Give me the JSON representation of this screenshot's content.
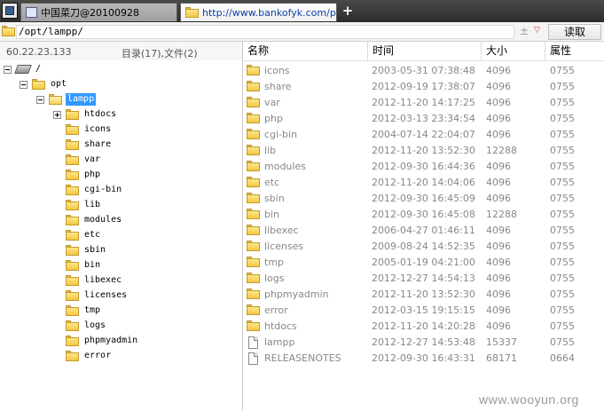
{
  "tabs": [
    {
      "label": "中国菜刀@20100928",
      "active": false
    },
    {
      "label": "http://www.bankofyk.com/pl...",
      "active": true
    }
  ],
  "new_tab_symbol": "+",
  "pathbar": {
    "path": "/opt/lampp/",
    "plusminus": "±",
    "dropdown": "▽",
    "read_button": "读取"
  },
  "left": {
    "ip": "60.22.23.133",
    "count": "目录(17),文件(2)",
    "tree": [
      {
        "label": "/",
        "kind": "drive",
        "expander": "minus"
      },
      {
        "label": "opt",
        "kind": "folder",
        "expander": "minus"
      },
      {
        "label": "lampp",
        "kind": "folder-open",
        "expander": "minus",
        "selected": true
      },
      {
        "label": "htdocs",
        "kind": "folder",
        "expander": "plus"
      },
      {
        "label": "icons",
        "kind": "folder"
      },
      {
        "label": "share",
        "kind": "folder"
      },
      {
        "label": "var",
        "kind": "folder"
      },
      {
        "label": "php",
        "kind": "folder"
      },
      {
        "label": "cgi-bin",
        "kind": "folder"
      },
      {
        "label": "lib",
        "kind": "folder"
      },
      {
        "label": "modules",
        "kind": "folder"
      },
      {
        "label": "etc",
        "kind": "folder"
      },
      {
        "label": "sbin",
        "kind": "folder"
      },
      {
        "label": "bin",
        "kind": "folder"
      },
      {
        "label": "libexec",
        "kind": "folder"
      },
      {
        "label": "licenses",
        "kind": "folder"
      },
      {
        "label": "tmp",
        "kind": "folder"
      },
      {
        "label": "logs",
        "kind": "folder"
      },
      {
        "label": "phpmyadmin",
        "kind": "folder"
      },
      {
        "label": "error",
        "kind": "folder"
      }
    ]
  },
  "columns": {
    "name": "名称",
    "time": "时间",
    "size": "大小",
    "attr": "属性"
  },
  "files": [
    {
      "name": "icons",
      "time": "2003-05-31 07:38:48",
      "size": "4096",
      "attr": "0755",
      "type": "dir"
    },
    {
      "name": "share",
      "time": "2012-09-19 17:38:07",
      "size": "4096",
      "attr": "0755",
      "type": "dir"
    },
    {
      "name": "var",
      "time": "2012-11-20 14:17:25",
      "size": "4096",
      "attr": "0755",
      "type": "dir"
    },
    {
      "name": "php",
      "time": "2012-03-13 23:34:54",
      "size": "4096",
      "attr": "0755",
      "type": "dir"
    },
    {
      "name": "cgi-bin",
      "time": "2004-07-14 22:04:07",
      "size": "4096",
      "attr": "0755",
      "type": "dir"
    },
    {
      "name": "lib",
      "time": "2012-11-20 13:52:30",
      "size": "12288",
      "attr": "0755",
      "type": "dir"
    },
    {
      "name": "modules",
      "time": "2012-09-30 16:44:36",
      "size": "4096",
      "attr": "0755",
      "type": "dir"
    },
    {
      "name": "etc",
      "time": "2012-11-20 14:04:06",
      "size": "4096",
      "attr": "0755",
      "type": "dir"
    },
    {
      "name": "sbin",
      "time": "2012-09-30 16:45:09",
      "size": "4096",
      "attr": "0755",
      "type": "dir"
    },
    {
      "name": "bin",
      "time": "2012-09-30 16:45:08",
      "size": "12288",
      "attr": "0755",
      "type": "dir"
    },
    {
      "name": "libexec",
      "time": "2006-04-27 01:46:11",
      "size": "4096",
      "attr": "0755",
      "type": "dir"
    },
    {
      "name": "licenses",
      "time": "2009-08-24 14:52:35",
      "size": "4096",
      "attr": "0755",
      "type": "dir"
    },
    {
      "name": "tmp",
      "time": "2005-01-19 04:21:00",
      "size": "4096",
      "attr": "0755",
      "type": "dir"
    },
    {
      "name": "logs",
      "time": "2012-12-27 14:54:13",
      "size": "4096",
      "attr": "0755",
      "type": "dir"
    },
    {
      "name": "phpmyadmin",
      "time": "2012-11-20 13:52:30",
      "size": "4096",
      "attr": "0755",
      "type": "dir"
    },
    {
      "name": "error",
      "time": "2012-03-15 19:15:15",
      "size": "4096",
      "attr": "0755",
      "type": "dir"
    },
    {
      "name": "htdocs",
      "time": "2012-11-20 14:20:28",
      "size": "4096",
      "attr": "0755",
      "type": "dir"
    },
    {
      "name": "lampp",
      "time": "2012-12-27 14:53:48",
      "size": "15337",
      "attr": "0755",
      "type": "file"
    },
    {
      "name": "RELEASENOTES",
      "time": "2012-09-30 16:43:31",
      "size": "68171",
      "attr": "0664",
      "type": "file"
    }
  ],
  "watermark": "www.wooyun.org"
}
